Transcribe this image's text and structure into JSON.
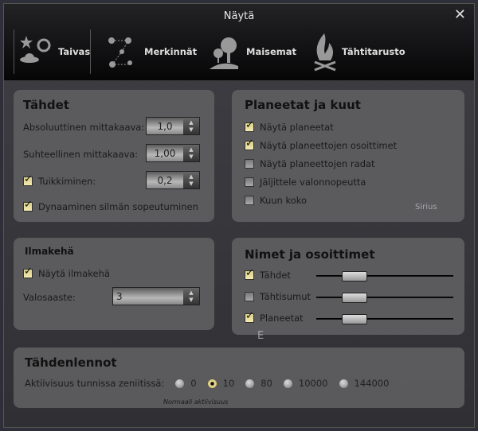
{
  "window": {
    "title": "Näytä",
    "close_icon": "close-x-icon"
  },
  "tabs": [
    {
      "label": "Taivas",
      "icon": "sky-icon"
    },
    {
      "label": "Merkinnät",
      "icon": "constellation-icon"
    },
    {
      "label": "Maisemat",
      "icon": "landscape-icon"
    },
    {
      "label": "Tähtitarusto",
      "icon": "campfire-icon"
    }
  ],
  "stars": {
    "title": "Tähdet",
    "abs_label": "Absoluuttinen mittakaava:",
    "abs_value": "1,0",
    "rel_label": "Suhteellinen mittakaava:",
    "rel_value": "1,00",
    "twinkle_label": "Tuikkiminen:",
    "twinkle_checked": true,
    "twinkle_value": "0,2",
    "dynamic_label": "Dynaaminen silmän sopeutuminen",
    "dynamic_checked": true
  },
  "planets": {
    "title": "Planeetat ja kuut",
    "items": [
      {
        "label": "Näytä planeetat",
        "checked": true
      },
      {
        "label": "Näytä planeettojen osoittimet",
        "checked": true
      },
      {
        "label": "Näytä planeettojen radat",
        "checked": false
      },
      {
        "label": "Jäljittele valonnopeutta",
        "checked": false
      },
      {
        "label": "Kuun koko",
        "checked": false
      }
    ]
  },
  "atmosphere": {
    "title": "Ilmakehä",
    "show_label": "Näytä ilmakehä",
    "show_checked": true,
    "pollution_label": "Valosaaste:",
    "pollution_value": "3"
  },
  "labels": {
    "title": "Nimet ja osoittimet",
    "items": [
      {
        "label": "Tähdet",
        "checked": true,
        "level": 0.25
      },
      {
        "label": "Tähtisumut",
        "checked": false,
        "level": 0.25
      },
      {
        "label": "Planeetat",
        "checked": true,
        "level": 0.25
      }
    ]
  },
  "meteors": {
    "title": "Tähdenlennot",
    "rate_label": "Aktiivisuus tunnissa zeniitissä:",
    "options": [
      "0",
      "10",
      "80",
      "10000",
      "144000"
    ],
    "selected": "10",
    "description": "Normaali aktiivisuus"
  },
  "sky_labels": {
    "sirius": "Sirius",
    "east": "E"
  }
}
